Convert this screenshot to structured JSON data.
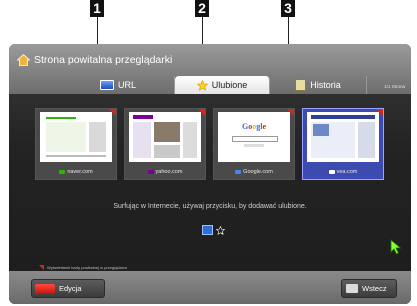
{
  "callouts": [
    "1",
    "2",
    "3"
  ],
  "title": "Strona powitalna przeglądarki",
  "tabs": [
    {
      "label": "URL",
      "icon": "url-icon"
    },
    {
      "label": "Ulubione",
      "icon": "star-icon",
      "active": true
    },
    {
      "label": "Historia",
      "icon": "history-icon"
    }
  ],
  "page_counter": "1/1 Strona",
  "favorites": [
    {
      "label": "naver.com",
      "icon": "naver-favicon",
      "icon_color": "#2db400"
    },
    {
      "label": "yahoo.com",
      "icon": "yahoo-favicon",
      "icon_color": "#7b0099"
    },
    {
      "label": "Google.com",
      "icon": "google-favicon",
      "icon_color": "#4285f4"
    },
    {
      "label": "vea.com",
      "icon": "vea-favicon",
      "icon_color": "#ffffff",
      "selected": true
    }
  ],
  "hint": "Surfując w Internecie, używaj przycisku, by dodawać ulubione.",
  "legend": "Wyświetlanie karty powitalnej w przeglądarce",
  "buttons": {
    "edit": "Edycja",
    "back": "Wstecz"
  },
  "colors": {
    "accent_red": "#d7261c",
    "selected_blue": "#3d4bb0",
    "star_yellow": "#ffd21f"
  }
}
